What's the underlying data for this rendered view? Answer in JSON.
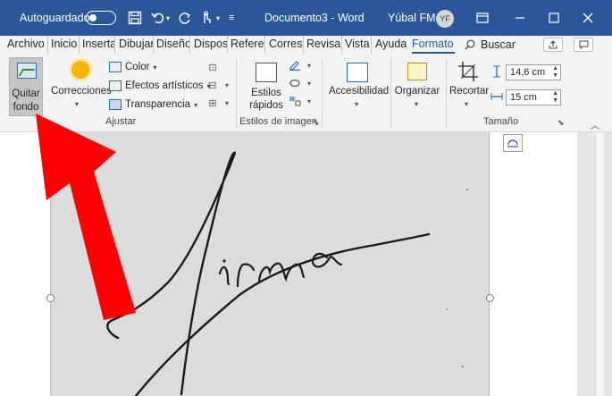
{
  "titlebar": {
    "autosave_label": "Autoguardado",
    "doc_title": "Documento3 - Word",
    "user_name": "Yúbal FM",
    "avatar_initials": "YF",
    "qat_icons": [
      "save-icon",
      "undo-icon",
      "redo-icon",
      "touch-mode-icon",
      "customize-qat-icon"
    ],
    "window_buttons": [
      "ribbon-display-icon",
      "minimize-icon",
      "maximize-icon",
      "close-icon"
    ]
  },
  "tabs": [
    {
      "label": "Archivo"
    },
    {
      "label": "Inicio"
    },
    {
      "label": "Inserta"
    },
    {
      "label": "Dibujar"
    },
    {
      "label": "Diseño"
    },
    {
      "label": "Dispos"
    },
    {
      "label": "Refere"
    },
    {
      "label": "Corres"
    },
    {
      "label": "Revisa"
    },
    {
      "label": "Vista"
    },
    {
      "label": "Ayuda"
    },
    {
      "label": "Formato"
    }
  ],
  "active_tab": "Formato",
  "search": {
    "label": "Buscar"
  },
  "ribbon": {
    "quitar_fondo": {
      "line1": "Quitar",
      "line2": "fondo"
    },
    "correcciones": {
      "label": "Correcciones"
    },
    "color": {
      "label": "Color"
    },
    "efectos": {
      "label": "Efectos artísticos"
    },
    "transparencia": {
      "label": "Transparencia"
    },
    "group_ajustar": "Ajustar",
    "estilos_rapidos": {
      "line1": "Estilos",
      "line2": "rápidos"
    },
    "group_estilos": "Estilos de imagen",
    "accesibilidad": {
      "label": "Accesibilidad"
    },
    "organizar": {
      "label": "Organizar"
    },
    "recortar": {
      "label": "Recortar"
    },
    "height_value": "14,6 cm",
    "width_value": "15 cm",
    "group_tamano": "Tamaño"
  },
  "colors": {
    "titlebar_bg": "#2b579a",
    "arrow": "#ff0000",
    "signature_ink": "#1a1a1a"
  }
}
